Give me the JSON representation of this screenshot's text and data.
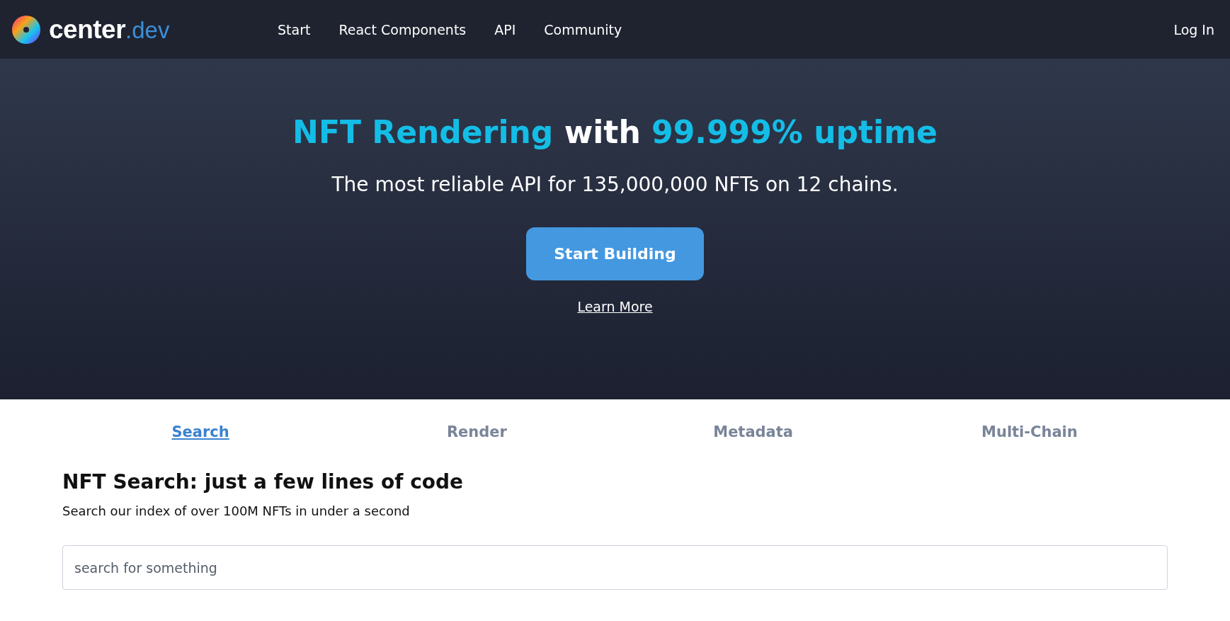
{
  "header": {
    "logo": {
      "name": "center",
      "suffix": ".dev"
    },
    "nav": [
      "Start",
      "React Components",
      "API",
      "Community"
    ],
    "login": "Log In"
  },
  "hero": {
    "headline": [
      {
        "text": "NFT Rendering",
        "accent": true
      },
      {
        "text": " with ",
        "accent": false
      },
      {
        "text": "99.999% uptime",
        "accent": true
      }
    ],
    "subtitle": "The most reliable API for 135,000,000 NFTs on 12 chains.",
    "button": "Start Building",
    "link": "Learn More"
  },
  "tabs": [
    {
      "label": "Search",
      "selected": true
    },
    {
      "label": "Render",
      "selected": false
    },
    {
      "label": "Metadata",
      "selected": false
    },
    {
      "label": "Multi-Chain",
      "selected": false
    }
  ],
  "section": {
    "title": "NFT Search: just a few lines of code",
    "description": "Search our index of over 100M NFTs in under a second",
    "search": {
      "placeholder": "search for something"
    }
  }
}
